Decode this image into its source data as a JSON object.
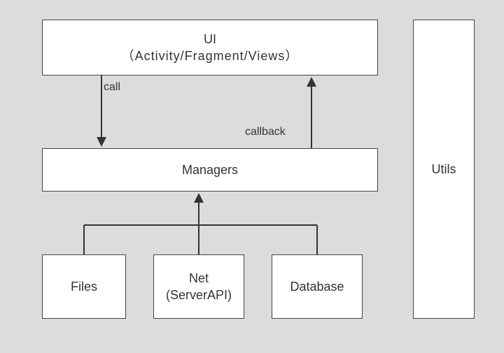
{
  "boxes": {
    "ui": {
      "title": "UI",
      "subtitle": "（Activity/Fragment/Views）"
    },
    "managers": {
      "title": "Managers"
    },
    "files": {
      "title": "Files"
    },
    "net": {
      "title": "Net",
      "subtitle": "(ServerAPI)"
    },
    "database": {
      "title": "Database"
    },
    "utils": {
      "title": "Utils"
    }
  },
  "labels": {
    "call": "call",
    "callback": "callback"
  }
}
